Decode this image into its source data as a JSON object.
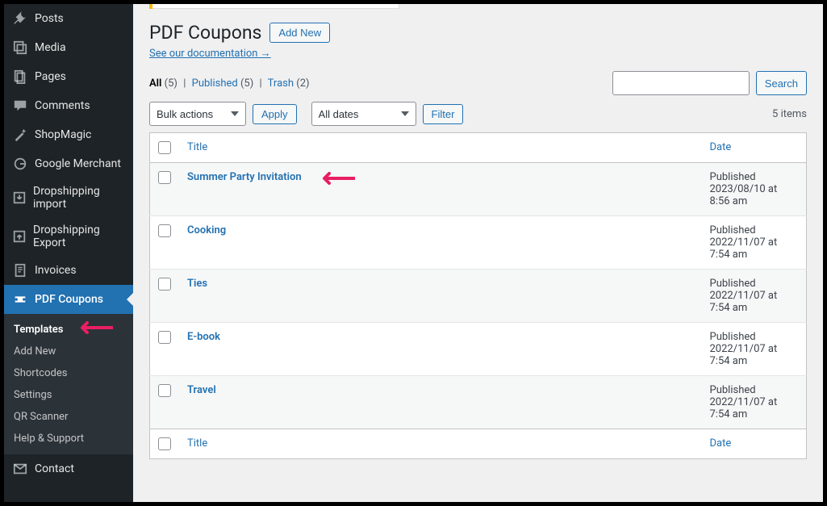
{
  "sidebar": {
    "items": [
      {
        "label": "Posts",
        "icon": "pin-icon"
      },
      {
        "label": "Media",
        "icon": "media-icon"
      },
      {
        "label": "Pages",
        "icon": "pages-icon"
      },
      {
        "label": "Comments",
        "icon": "comments-icon"
      },
      {
        "label": "ShopMagic",
        "icon": "wand-icon"
      },
      {
        "label": "Google Merchant",
        "icon": "google-icon"
      },
      {
        "label": "Dropshipping import",
        "icon": "import-icon"
      },
      {
        "label": "Dropshipping Export",
        "icon": "export-icon"
      },
      {
        "label": "Invoices",
        "icon": "invoices-icon"
      },
      {
        "label": "PDF Coupons",
        "icon": "ticket-icon"
      },
      {
        "label": "Contact",
        "icon": "mail-icon"
      }
    ],
    "submenu": [
      {
        "label": "Templates",
        "current": true
      },
      {
        "label": "Add New"
      },
      {
        "label": "Shortcodes"
      },
      {
        "label": "Settings"
      },
      {
        "label": "QR Scanner"
      },
      {
        "label": "Help & Support"
      }
    ]
  },
  "page": {
    "title": "PDF Coupons",
    "add_new": "Add New",
    "doc_link": "See our documentation →"
  },
  "filters": {
    "all_label": "All",
    "all_count": "(5)",
    "published_label": "Published",
    "published_count": "(5)",
    "trash_label": "Trash",
    "trash_count": "(2)",
    "search_btn": "Search",
    "bulk_actions": "Bulk actions",
    "apply": "Apply",
    "all_dates": "All dates",
    "filter": "Filter",
    "item_count": "5 items"
  },
  "table": {
    "col_title": "Title",
    "col_date": "Date",
    "rows": [
      {
        "title": "Summer Party Invitation",
        "status": "Published",
        "date": "2023/08/10 at 8:56 am"
      },
      {
        "title": "Cooking",
        "status": "Published",
        "date": "2022/11/07 at 7:54 am"
      },
      {
        "title": "Ties",
        "status": "Published",
        "date": "2022/11/07 at 7:54 am"
      },
      {
        "title": "E-book",
        "status": "Published",
        "date": "2022/11/07 at 7:54 am"
      },
      {
        "title": "Travel",
        "status": "Published",
        "date": "2022/11/07 at 7:54 am"
      }
    ]
  }
}
